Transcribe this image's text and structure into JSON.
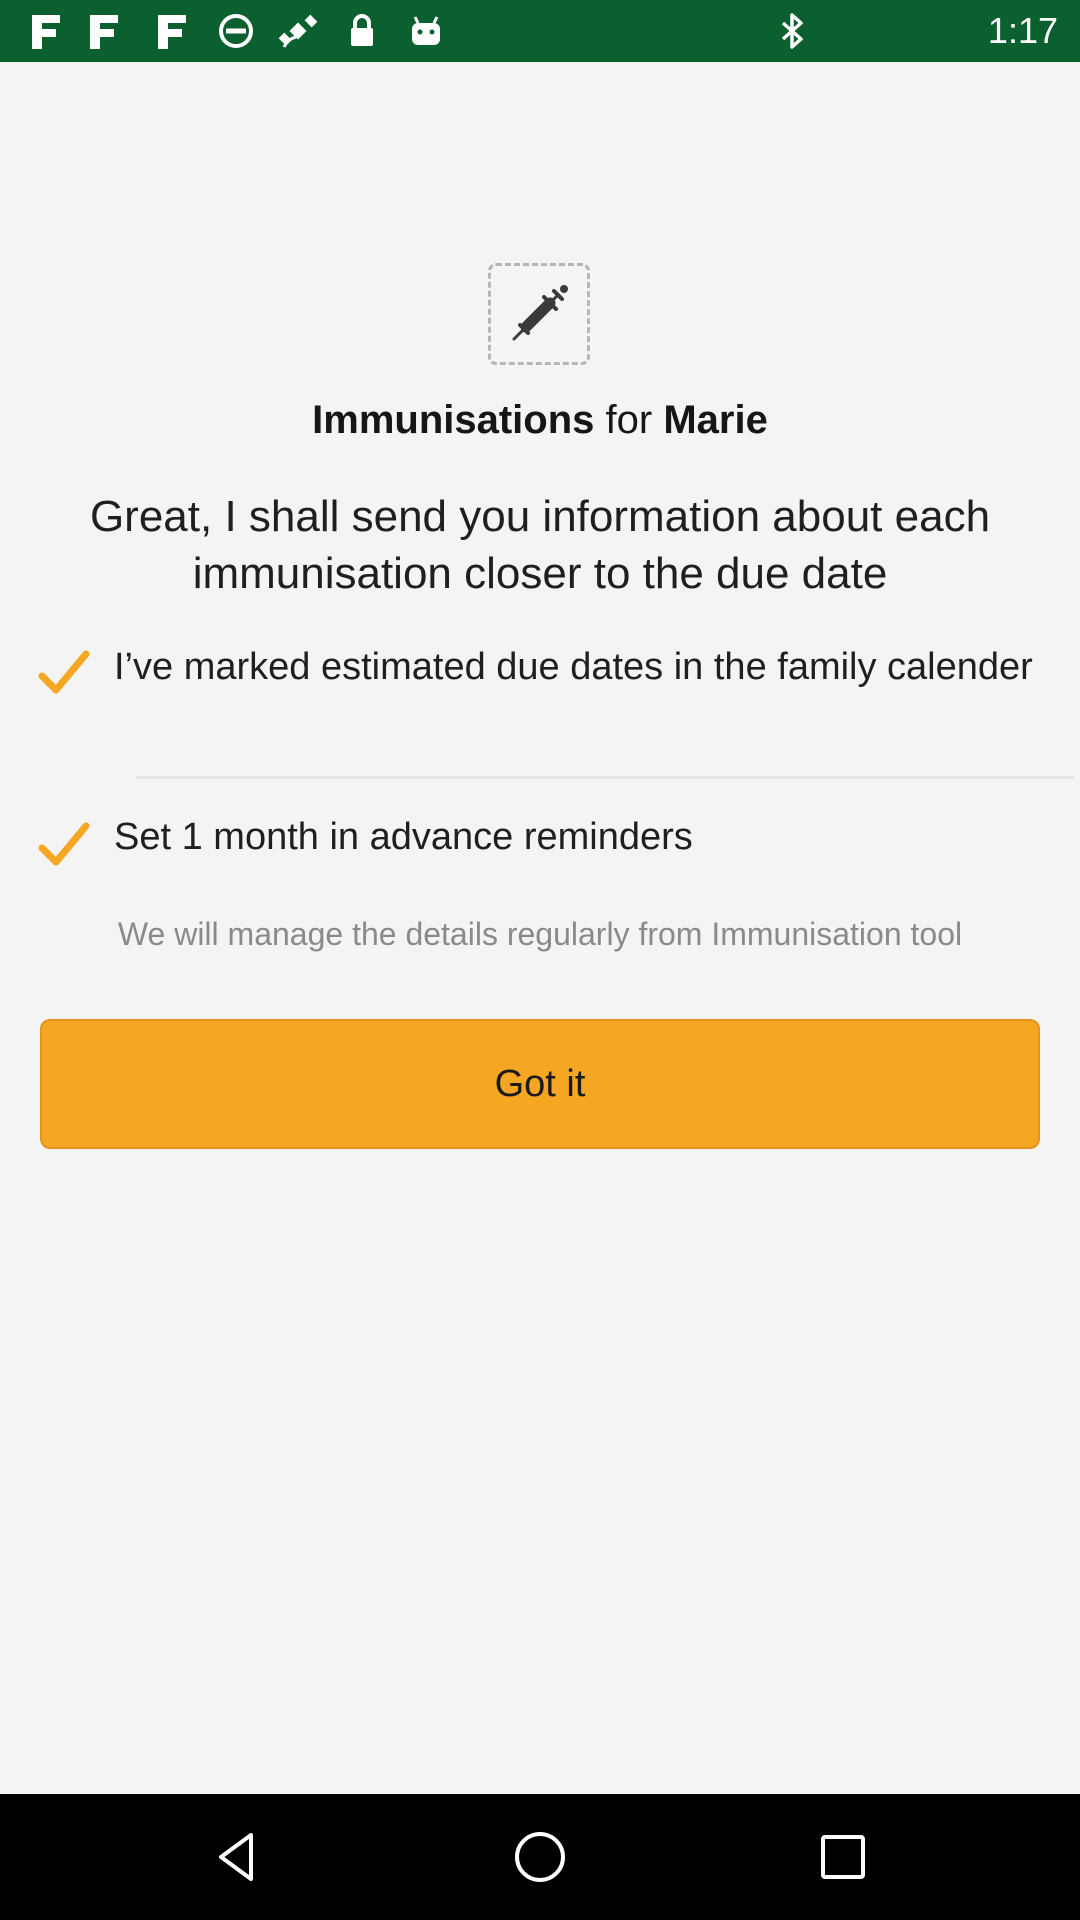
{
  "status_bar": {
    "time": "1:17",
    "left_icons": [
      "news-icon",
      "news-icon",
      "news-icon",
      "no-sim-icon",
      "fake-gps-satellite-icon",
      "lock-icon",
      "android-icon"
    ],
    "right_icons": [
      "bluetooth-icon"
    ],
    "background": "#0c5f2e"
  },
  "header": {
    "icon": "syringe-icon",
    "title_bold": "Immunisations",
    "title_connector": "for",
    "title_name": "Marie"
  },
  "headline": "Great, I shall send you information about each immunisation closer to the due date",
  "checklist": [
    {
      "icon": "checkmark-icon",
      "text": "I’ve marked estimated due dates in the family calender"
    },
    {
      "icon": "checkmark-icon",
      "text": "Set 1 month in advance reminders"
    }
  ],
  "note": "We will manage the details regularly from Immunisation tool",
  "primary_button": {
    "label": "Got it",
    "color": "#f5a623"
  },
  "nav_bar": {
    "buttons": [
      "back-triangle-icon",
      "home-circle-icon",
      "recents-square-icon"
    ]
  },
  "colors": {
    "accent": "#f5a623",
    "background": "#f4f4f4"
  }
}
